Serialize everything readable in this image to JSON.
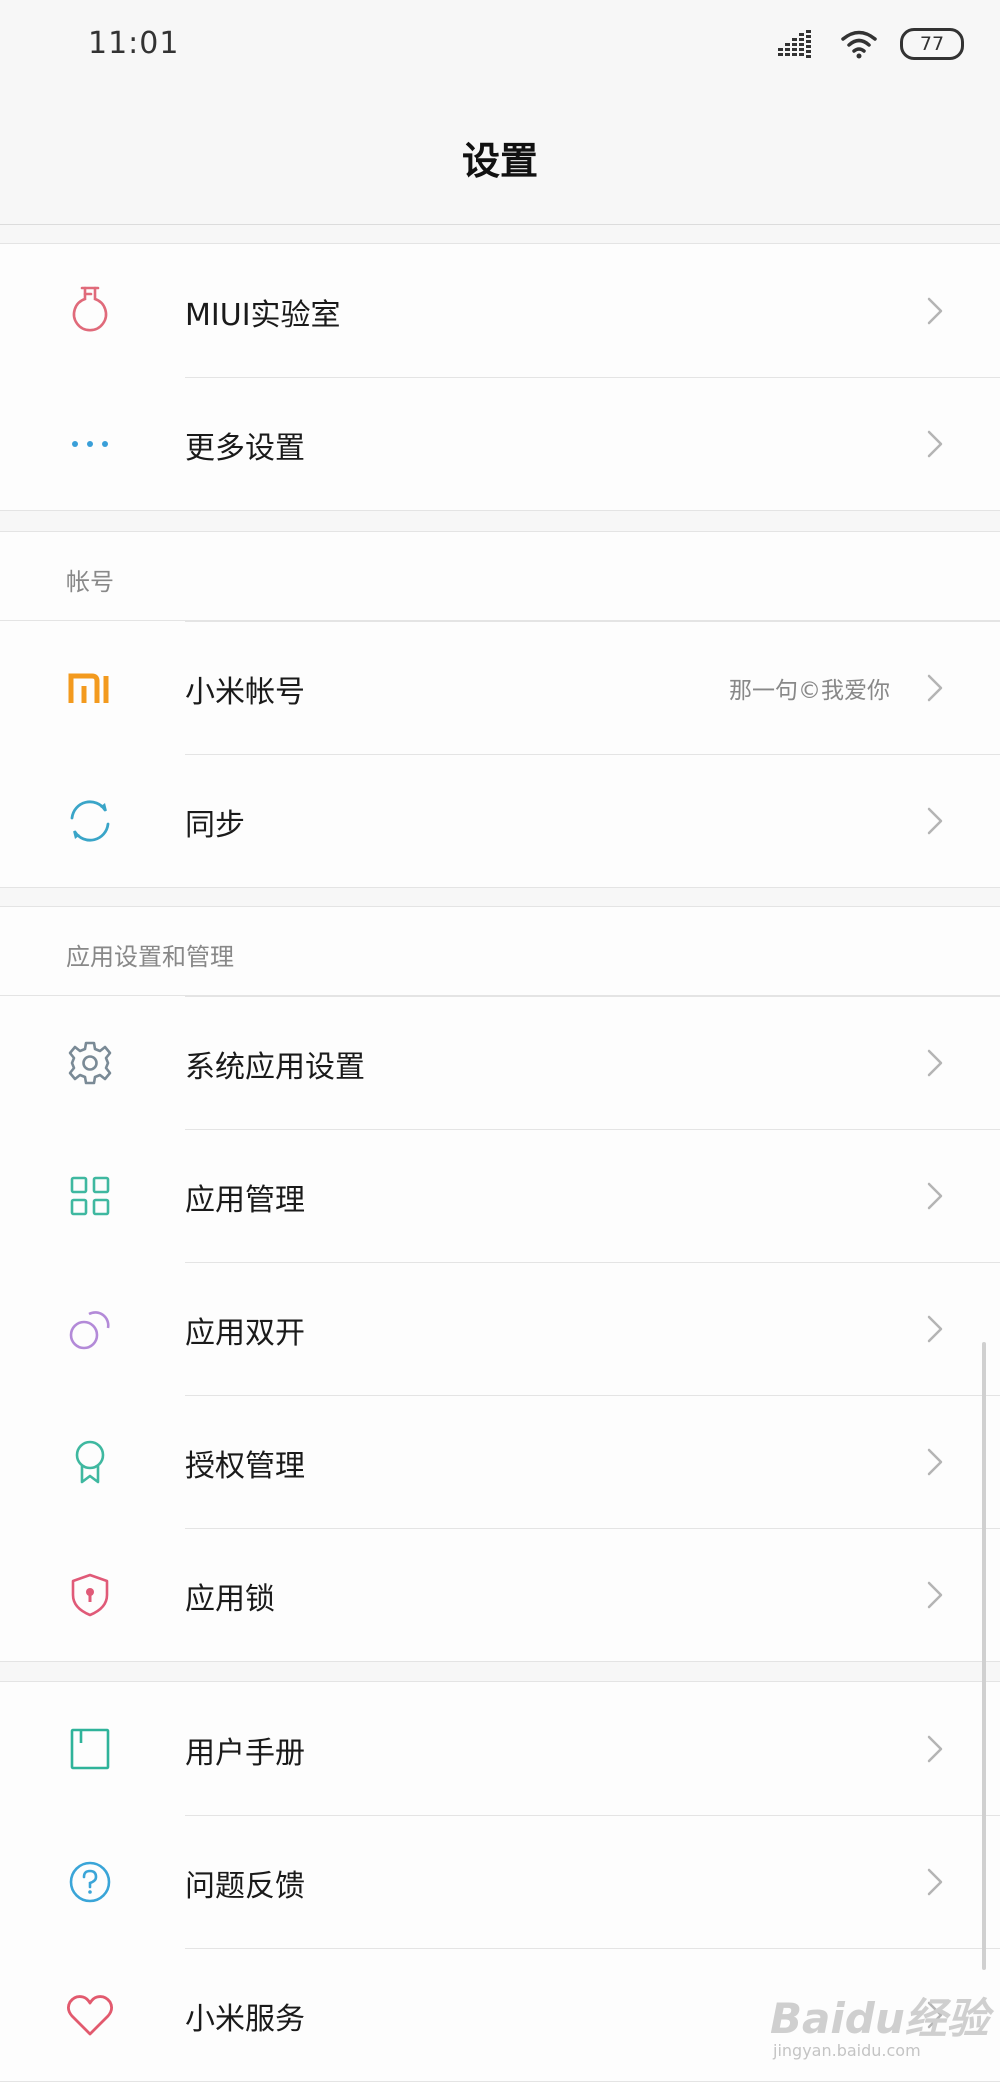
{
  "status": {
    "time": "11:01",
    "battery": "77"
  },
  "header": {
    "title": "设置"
  },
  "group1": {
    "items": [
      {
        "label": "MIUI实验室"
      },
      {
        "label": "更多设置"
      }
    ]
  },
  "account": {
    "title": "帐号",
    "items": [
      {
        "label": "小米帐号",
        "value": "那一句©我爱你"
      },
      {
        "label": "同步"
      }
    ]
  },
  "apps": {
    "title": "应用设置和管理",
    "items": [
      {
        "label": "系统应用设置"
      },
      {
        "label": "应用管理"
      },
      {
        "label": "应用双开"
      },
      {
        "label": "授权管理"
      },
      {
        "label": "应用锁"
      }
    ]
  },
  "help": {
    "items": [
      {
        "label": "用户手册"
      },
      {
        "label": "问题反馈"
      },
      {
        "label": "小米服务"
      }
    ]
  },
  "watermark": {
    "logo_text": "Baidu经验",
    "url_text": "jingyan.baidu.com"
  },
  "colors": {
    "lab_icon": "#e06a7a",
    "more_icon": "#3a9fd8",
    "mi_icon": "#f39a1e",
    "sync_icon": "#3aa5c8",
    "gear_icon": "#7a8a96",
    "grid_icon": "#3fb8a0",
    "dual_icon": "#b38ad8",
    "auth_icon": "#3fb8a0",
    "lock_icon": "#e05a78",
    "manual_icon": "#2fb39a",
    "feedback_icon": "#3aa5d8",
    "heart_icon": "#e25a6e"
  }
}
